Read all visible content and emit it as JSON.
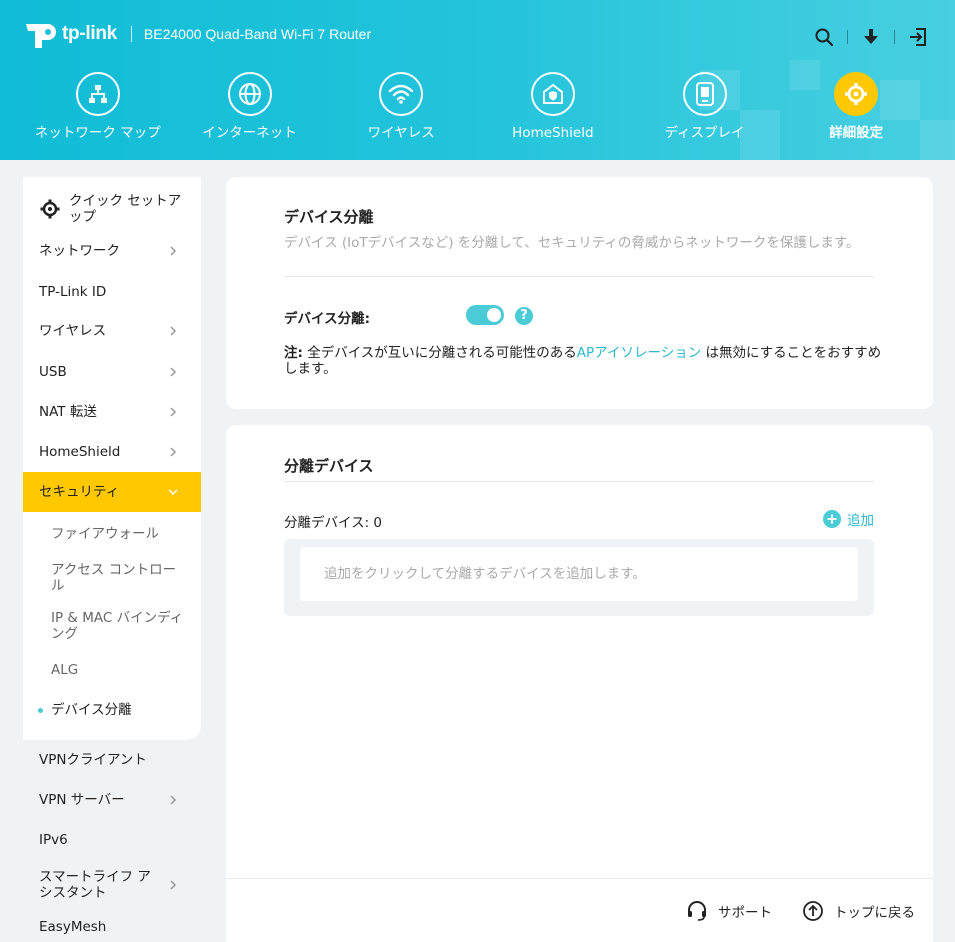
{
  "header": {
    "brand": "tp-link",
    "model": "BE24000 Quad-Band Wi-Fi 7 Router",
    "accent_color": "#1fc0d8",
    "active_color": "#ffc800",
    "icons": [
      "search-icon",
      "download-icon",
      "logout-icon"
    ]
  },
  "nav": [
    {
      "label": "ネットワーク マップ",
      "icon": "network-map-icon"
    },
    {
      "label": "インターネット",
      "icon": "globe-icon"
    },
    {
      "label": "ワイヤレス",
      "icon": "wifi-icon"
    },
    {
      "label": "HomeShield",
      "icon": "homeshield-icon"
    },
    {
      "label": "ディスプレイ",
      "icon": "display-icon"
    },
    {
      "label": "詳細設定",
      "icon": "gear-icon"
    }
  ],
  "sidebar": {
    "quick_setup": "クイック セットアップ",
    "items": [
      {
        "label": "ネットワーク"
      },
      {
        "label": "TP-Link ID"
      },
      {
        "label": "ワイヤレス"
      },
      {
        "label": "USB"
      },
      {
        "label": "NAT 転送"
      },
      {
        "label": "HomeShield"
      },
      {
        "label": "セキュリティ"
      }
    ],
    "security_sub": [
      {
        "label": "ファイアウォール"
      },
      {
        "label": "アクセス コントロール"
      },
      {
        "label": "IP & MAC バインディング"
      },
      {
        "label": "ALG"
      },
      {
        "label": "デバイス分離"
      }
    ],
    "items_after": [
      {
        "label": "VPNクライアント"
      },
      {
        "label": "VPN サーバー"
      },
      {
        "label": "IPv6"
      },
      {
        "label": "スマートライフ アシスタント"
      },
      {
        "label": "EasyMesh"
      }
    ]
  },
  "device_isolation": {
    "title": "デバイス分離",
    "description": "デバイス (IoTデバイスなど) を分離して、セキュリティの脅威からネットワークを保護します。",
    "toggle_label": "デバイス分離:",
    "toggle_on": true,
    "help": "?",
    "note_prefix": "注:",
    "note_before_link": " 全デバイスが互いに分離される可能性のある",
    "note_link": "APアイソレーション",
    "note_after_link": " は無効にすることをおすすめします。"
  },
  "isolated_devices": {
    "title": "分離デバイス",
    "count_label": "分離デバイス: 0",
    "add_label": "追加",
    "empty_text": "追加をクリックして分離するデバイスを追加します。"
  },
  "footer": {
    "support": "サポート",
    "back_to_top": "トップに戻る"
  }
}
